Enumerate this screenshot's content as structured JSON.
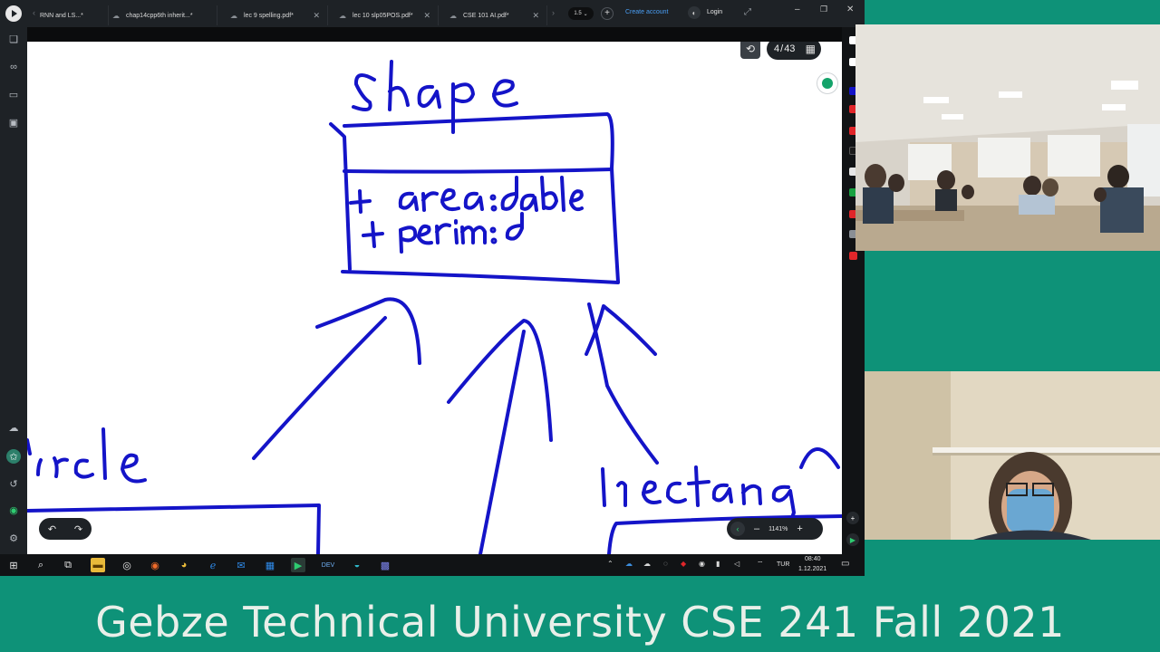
{
  "tabs": [
    {
      "label": "RNN and LS...*"
    },
    {
      "label": "chap14cpp6th inherit...*"
    },
    {
      "label": "lec 9 spelling.pdf*"
    },
    {
      "label": "lec 10 slp05POS.pdf*"
    },
    {
      "label": "CSE 101 AI.pdf*"
    }
  ],
  "toolbar": {
    "version": "1.5",
    "create_account": "Create account",
    "login": "Login"
  },
  "page": {
    "current": "4",
    "total": "43"
  },
  "zoom": {
    "level": "1141%"
  },
  "whiteboard": {
    "class_name": "Shape",
    "members": [
      "+ area : dable",
      "+ perim : d"
    ],
    "sub_left": "circle",
    "sub_right": "rectang",
    "ink_color": "#1414c8"
  },
  "taskbar": {
    "language": "TUR",
    "time": "08:40",
    "date": "1.12.2021"
  },
  "caption": "Gebze Technical University CSE 241 Fall 2021",
  "colors": {
    "background": "#0e9278",
    "app_dark": "#1e2226",
    "accent_blue": "#4a9ff5"
  }
}
